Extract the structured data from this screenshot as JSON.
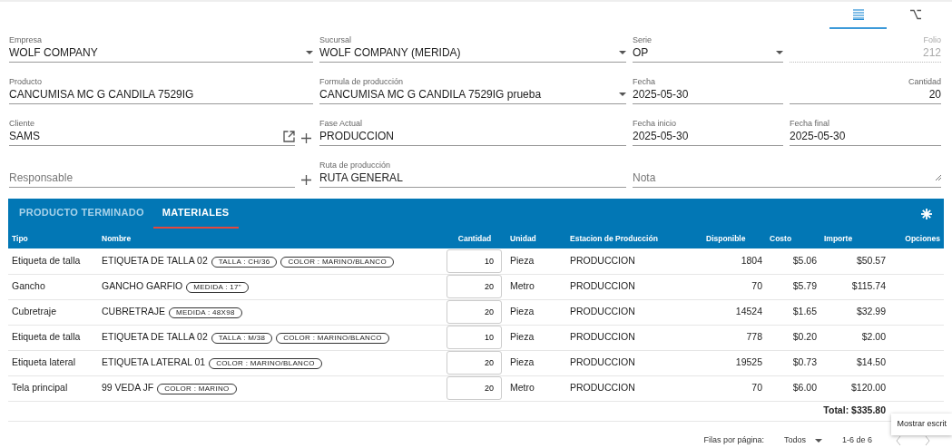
{
  "view_tabs": [
    {
      "kind": "list",
      "selected": true
    },
    {
      "kind": "option",
      "selected": false
    }
  ],
  "fields": [
    {
      "label": "Empresa",
      "value": "WOLF COMPANY",
      "kind": "select"
    },
    {
      "label": "Sucursal",
      "value": "WOLF COMPANY (MERIDA)",
      "kind": "select"
    },
    {
      "label": "Serie",
      "value": "OP",
      "kind": "select"
    },
    {
      "label": "Folio",
      "value": "212",
      "kind": "number",
      "disabled": true
    },
    {
      "label": "Producto",
      "value": "CANCUMISA MC G CANDILA 7529IG",
      "kind": "text"
    },
    {
      "label": "Formula de producción",
      "value": "CANCUMISA MC G CANDILA 7529IG prueba",
      "kind": "select"
    },
    {
      "label": "Fecha",
      "value": "2025-05-30",
      "kind": "text"
    },
    {
      "label": "Cantidad",
      "value": "20",
      "kind": "number"
    },
    {
      "label": "Cliente",
      "value": "SAMS",
      "kind": "text",
      "open_link": true,
      "add_button": true
    },
    {
      "label": "Fase Actual",
      "value": "PRODUCCION",
      "kind": "text"
    },
    {
      "label": "Fecha inicio",
      "value": "2025-05-30",
      "kind": "text"
    },
    {
      "label": "Fecha final",
      "value": "2025-05-30",
      "kind": "text"
    },
    {
      "placeholder": "Responsable",
      "kind": "text",
      "add_button": true
    },
    {
      "label": "Ruta de producción",
      "value": "RUTA GENERAL",
      "kind": "text"
    },
    {
      "placeholder": "Nota",
      "kind": "textarea"
    }
  ],
  "panel_tabs": [
    {
      "label": "PRODUCTO TERMINADO",
      "selected": false
    },
    {
      "label": "MATERIALES",
      "selected": true
    }
  ],
  "table": {
    "columns": [
      "Tipo",
      "Nombre",
      "Cantidad",
      "Unidad",
      "Estacion de Producción",
      "Disponible",
      "Costo",
      "Importe",
      "Opciones"
    ],
    "rows": [
      {
        "tipo": "Etiqueta de talla",
        "nombre": "ETIQUETA DE TALLA 02",
        "attributes": [
          "TALLA : CH/36",
          "COLOR : MARINO/BLANCO"
        ],
        "cantidad": "10",
        "unidad": "Pieza",
        "estacion": "PRODUCCION",
        "disponible": "1804",
        "costo": "$5.06",
        "importe": "$50.57"
      },
      {
        "tipo": "Gancho",
        "nombre": "GANCHO GARFIO",
        "attributes": [
          "MEDIDA : 17\""
        ],
        "cantidad": "20",
        "unidad": "Metro",
        "estacion": "PRODUCCION",
        "disponible": "70",
        "costo": "$5.79",
        "importe": "$115.74"
      },
      {
        "tipo": "Cubretraje",
        "nombre": "CUBRETRAJE",
        "attributes": [
          "MEDIDA : 48X98"
        ],
        "cantidad": "20",
        "unidad": "Pieza",
        "estacion": "PRODUCCION",
        "disponible": "14524",
        "costo": "$1.65",
        "importe": "$32.99"
      },
      {
        "tipo": "Etiqueta de talla",
        "nombre": "ETIQUETA DE TALLA 02",
        "attributes": [
          "TALLA : M/38",
          "COLOR : MARINO/BLANCO"
        ],
        "cantidad": "10",
        "unidad": "Pieza",
        "estacion": "PRODUCCION",
        "disponible": "778",
        "costo": "$0.20",
        "importe": "$2.00"
      },
      {
        "tipo": "Etiqueta lateral",
        "nombre": "ETIQUETA LATERAL 01",
        "attributes": [
          "COLOR : MARINO/BLANCO"
        ],
        "cantidad": "20",
        "unidad": "Pieza",
        "estacion": "PRODUCCION",
        "disponible": "19525",
        "costo": "$0.73",
        "importe": "$14.50"
      },
      {
        "tipo": "Tela principal",
        "nombre": "99 VEDA JF",
        "attributes": [
          "COLOR : MARINO"
        ],
        "cantidad": "20",
        "unidad": "Metro",
        "estacion": "PRODUCCION",
        "disponible": "70",
        "costo": "$6.00",
        "importe": "$120.00"
      }
    ],
    "total": "Total: $335.80"
  },
  "pagination": {
    "rows_label": "Filas por página:",
    "rows_value": "Todos",
    "range": "1-6 de 6"
  },
  "tooltip": "Mostrar escrit"
}
